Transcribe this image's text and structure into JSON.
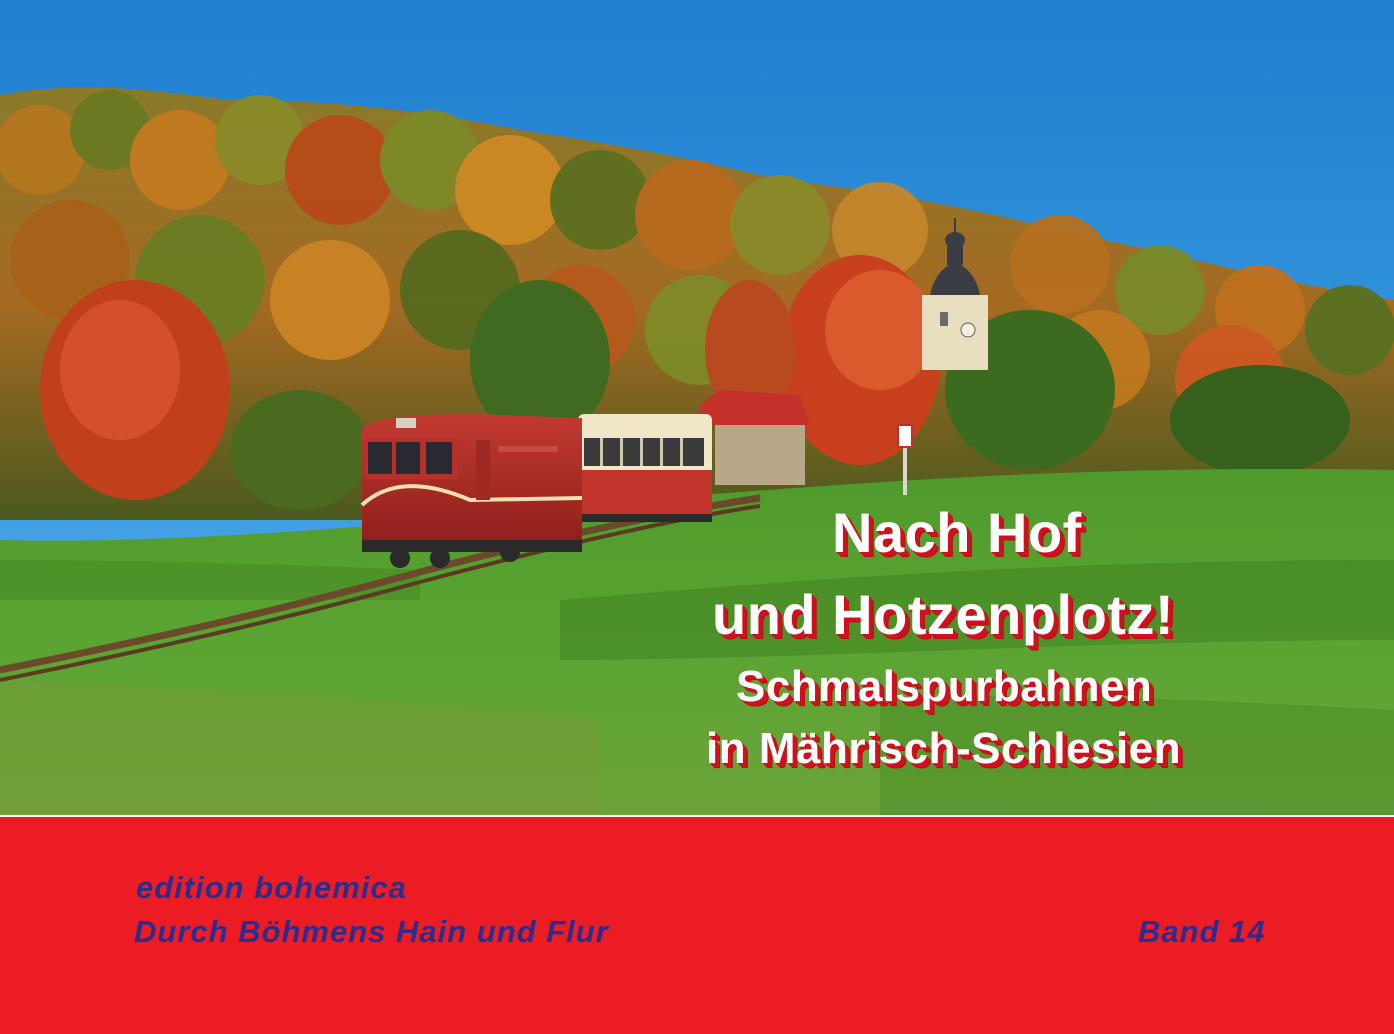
{
  "title": {
    "line1": "Nach Hof",
    "line2": "und Hotzenplotz!",
    "subtitle_line1": "Schmalspurbahnen",
    "subtitle_line2": "in Mährisch-Schlesien"
  },
  "band": {
    "publisher": "edition bohemica",
    "series": "Durch Böhmens Hain und Flur",
    "volume": "Band 14"
  },
  "colors": {
    "band_red": "#ec1c24",
    "band_text_blue": "#2a2c8e",
    "title_shadow_red": "#d0101c",
    "sky_blue": "#2b8fd6"
  }
}
